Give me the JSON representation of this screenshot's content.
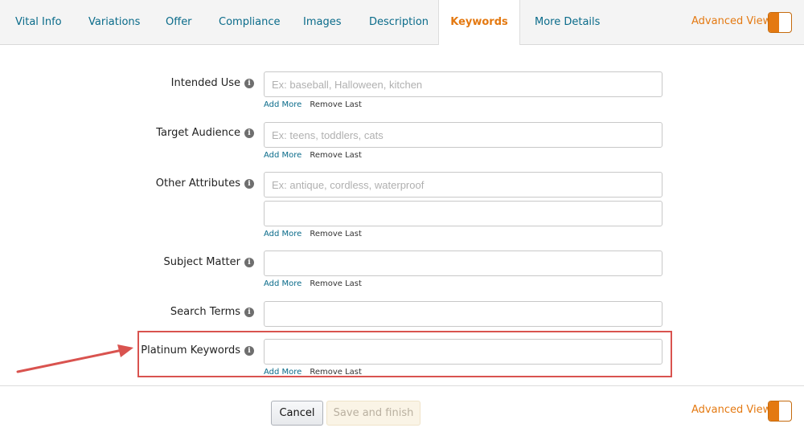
{
  "tabs": [
    {
      "label": "Vital Info",
      "active": false
    },
    {
      "label": "Variations",
      "active": false
    },
    {
      "label": "Offer",
      "active": false
    },
    {
      "label": "Compliance",
      "active": false
    },
    {
      "label": "Images",
      "active": false
    },
    {
      "label": "Description",
      "active": false
    },
    {
      "label": "Keywords",
      "active": true
    },
    {
      "label": "More Details",
      "active": false
    }
  ],
  "advanced_view_label": "Advanced View",
  "fields": [
    {
      "label": "Intended Use",
      "placeholder": "Ex: baseball, Halloween, kitchen",
      "second_placeholder": ""
    },
    {
      "label": "Target Audience",
      "placeholder": "Ex: teens, toddlers, cats"
    },
    {
      "label": "Other Attributes",
      "placeholder": "Ex: antique, cordless, waterproof"
    },
    {
      "label": "Subject Matter",
      "placeholder": ""
    },
    {
      "label": "Search Terms",
      "placeholder": ""
    },
    {
      "label": "Platinum Keywords",
      "placeholder": ""
    }
  ],
  "links": {
    "add_more": "Add More",
    "remove_last": "Remove Last"
  },
  "info_icon_glyph": "i",
  "buttons": {
    "cancel": "Cancel",
    "save": "Save and finish"
  },
  "colors": {
    "accent": "#e47911",
    "link": "#0a6b8a",
    "highlight": "#d9534f"
  }
}
